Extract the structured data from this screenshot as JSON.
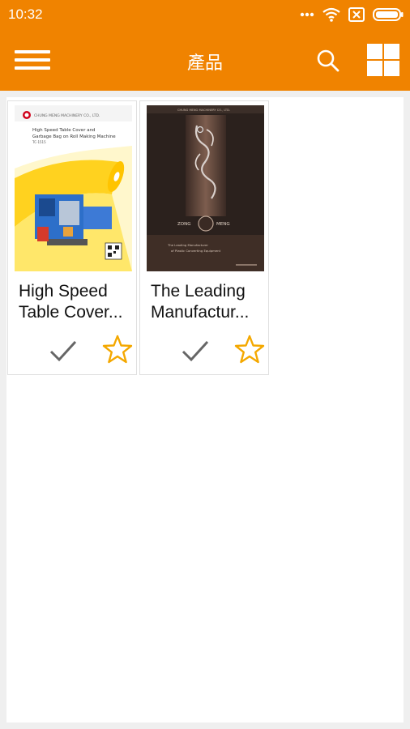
{
  "status_bar": {
    "time": "10:32",
    "icons": [
      "more-dots-icon",
      "wifi-icon",
      "sim-missing-icon",
      "battery-icon"
    ]
  },
  "app_bar": {
    "title": "產品",
    "menu_icon": "hamburger-menu-icon",
    "search_icon": "search-icon",
    "grid_icon": "grid-view-icon",
    "color": "#f08300"
  },
  "products": [
    {
      "name_line1": "High Speed",
      "name_line2": "Table Cover...",
      "cover": {
        "company": "CHUNG MENG MACHINERY CO., LTD.",
        "headline": "High Speed Table Cover and Garbage Bag on Roll Making Machine",
        "model": "TC-1515"
      }
    },
    {
      "name_line1": "The Leading",
      "name_line2": "Manufactur...",
      "cover": {
        "company": "CHUNG MENG MACHINERY CO., LTD.",
        "brand_left": "ZONG",
        "brand_right": "MENG",
        "tagline": "The Leading Manufacturer of Plastic Converting Equipment"
      }
    }
  ],
  "accent_star_color": "#f4a800"
}
